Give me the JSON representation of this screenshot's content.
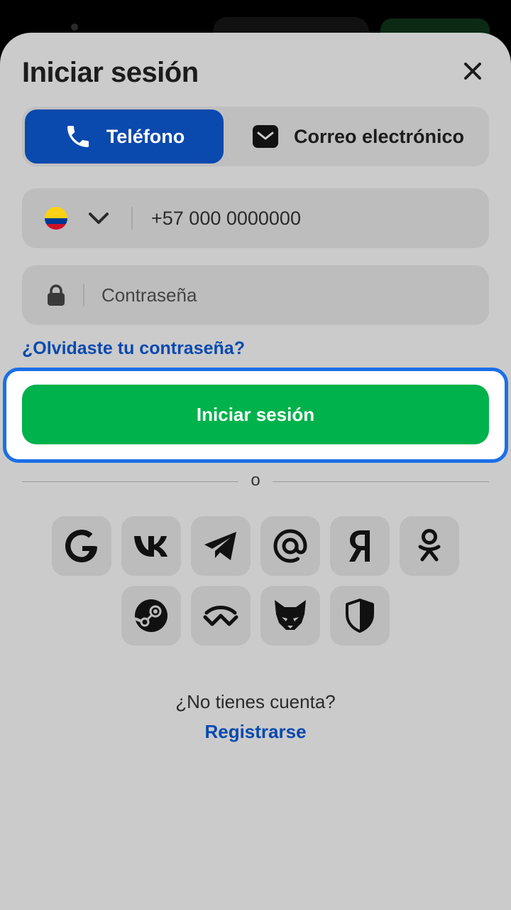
{
  "sheet": {
    "title": "Iniciar sesión"
  },
  "tabs": {
    "phone_label": "Teléfono",
    "email_label": "Correo electrónico",
    "active": "phone"
  },
  "phone_field": {
    "country_flag": "colombia-flag",
    "value": "+57 000 0000000"
  },
  "password_field": {
    "placeholder": "Contraseña"
  },
  "forgot_link": "¿Olvidaste tu contraseña?",
  "login_button": "Iniciar sesión",
  "divider_text": "o",
  "social_logins": [
    "google-icon",
    "vk-icon",
    "telegram-icon",
    "mail-ru-icon",
    "yandex-icon",
    "odnoklassniki-icon",
    "steam-icon",
    "walletconnect-icon",
    "metamask-fox-icon",
    "shield-icon"
  ],
  "footer": {
    "prompt": "¿No tienes cuenta?",
    "register_link": "Registrarse"
  },
  "colors": {
    "primary_blue": "#0a49ae",
    "login_green": "#00b24c",
    "highlight_border": "#1c6fe6",
    "sheet_bg": "#cbcbcb"
  }
}
